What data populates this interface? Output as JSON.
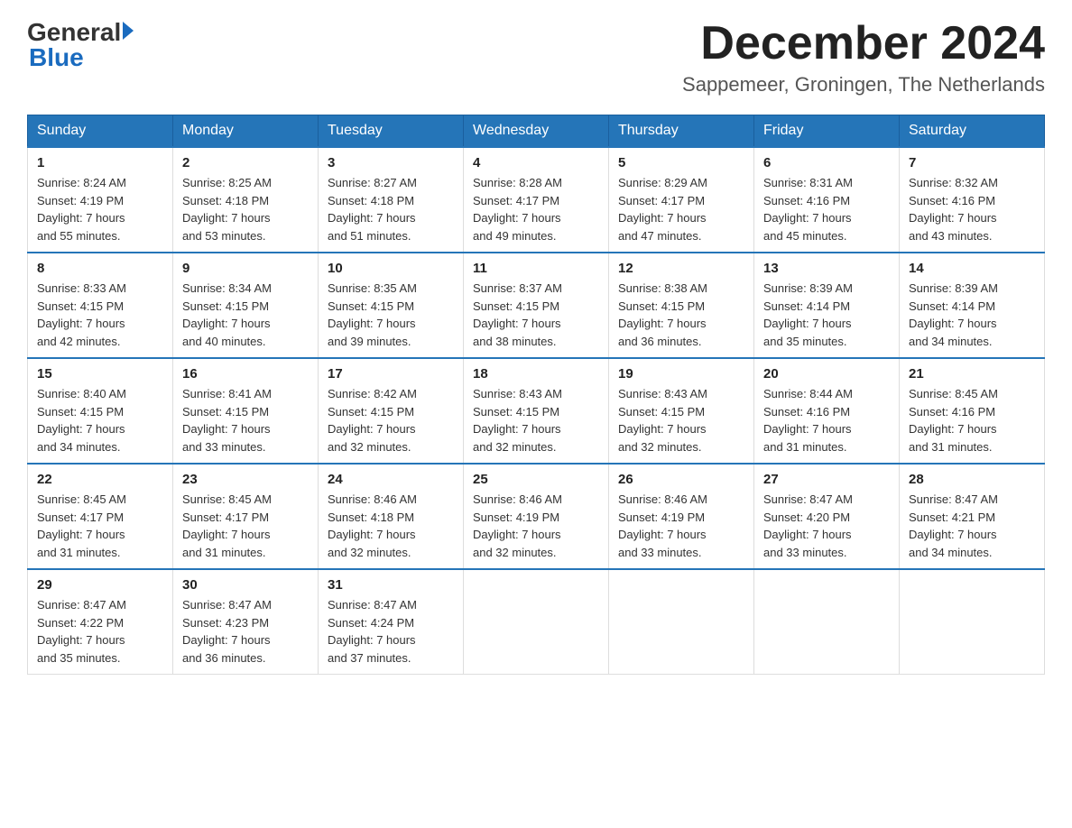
{
  "logo": {
    "general": "General",
    "blue": "Blue"
  },
  "header": {
    "month_year": "December 2024",
    "location": "Sappemeer, Groningen, The Netherlands"
  },
  "weekdays": [
    "Sunday",
    "Monday",
    "Tuesday",
    "Wednesday",
    "Thursday",
    "Friday",
    "Saturday"
  ],
  "weeks": [
    [
      {
        "day": "1",
        "sunrise": "8:24 AM",
        "sunset": "4:19 PM",
        "daylight": "7 hours and 55 minutes."
      },
      {
        "day": "2",
        "sunrise": "8:25 AM",
        "sunset": "4:18 PM",
        "daylight": "7 hours and 53 minutes."
      },
      {
        "day": "3",
        "sunrise": "8:27 AM",
        "sunset": "4:18 PM",
        "daylight": "7 hours and 51 minutes."
      },
      {
        "day": "4",
        "sunrise": "8:28 AM",
        "sunset": "4:17 PM",
        "daylight": "7 hours and 49 minutes."
      },
      {
        "day": "5",
        "sunrise": "8:29 AM",
        "sunset": "4:17 PM",
        "daylight": "7 hours and 47 minutes."
      },
      {
        "day": "6",
        "sunrise": "8:31 AM",
        "sunset": "4:16 PM",
        "daylight": "7 hours and 45 minutes."
      },
      {
        "day": "7",
        "sunrise": "8:32 AM",
        "sunset": "4:16 PM",
        "daylight": "7 hours and 43 minutes."
      }
    ],
    [
      {
        "day": "8",
        "sunrise": "8:33 AM",
        "sunset": "4:15 PM",
        "daylight": "7 hours and 42 minutes."
      },
      {
        "day": "9",
        "sunrise": "8:34 AM",
        "sunset": "4:15 PM",
        "daylight": "7 hours and 40 minutes."
      },
      {
        "day": "10",
        "sunrise": "8:35 AM",
        "sunset": "4:15 PM",
        "daylight": "7 hours and 39 minutes."
      },
      {
        "day": "11",
        "sunrise": "8:37 AM",
        "sunset": "4:15 PM",
        "daylight": "7 hours and 38 minutes."
      },
      {
        "day": "12",
        "sunrise": "8:38 AM",
        "sunset": "4:15 PM",
        "daylight": "7 hours and 36 minutes."
      },
      {
        "day": "13",
        "sunrise": "8:39 AM",
        "sunset": "4:14 PM",
        "daylight": "7 hours and 35 minutes."
      },
      {
        "day": "14",
        "sunrise": "8:39 AM",
        "sunset": "4:14 PM",
        "daylight": "7 hours and 34 minutes."
      }
    ],
    [
      {
        "day": "15",
        "sunrise": "8:40 AM",
        "sunset": "4:15 PM",
        "daylight": "7 hours and 34 minutes."
      },
      {
        "day": "16",
        "sunrise": "8:41 AM",
        "sunset": "4:15 PM",
        "daylight": "7 hours and 33 minutes."
      },
      {
        "day": "17",
        "sunrise": "8:42 AM",
        "sunset": "4:15 PM",
        "daylight": "7 hours and 32 minutes."
      },
      {
        "day": "18",
        "sunrise": "8:43 AM",
        "sunset": "4:15 PM",
        "daylight": "7 hours and 32 minutes."
      },
      {
        "day": "19",
        "sunrise": "8:43 AM",
        "sunset": "4:15 PM",
        "daylight": "7 hours and 32 minutes."
      },
      {
        "day": "20",
        "sunrise": "8:44 AM",
        "sunset": "4:16 PM",
        "daylight": "7 hours and 31 minutes."
      },
      {
        "day": "21",
        "sunrise": "8:45 AM",
        "sunset": "4:16 PM",
        "daylight": "7 hours and 31 minutes."
      }
    ],
    [
      {
        "day": "22",
        "sunrise": "8:45 AM",
        "sunset": "4:17 PM",
        "daylight": "7 hours and 31 minutes."
      },
      {
        "day": "23",
        "sunrise": "8:45 AM",
        "sunset": "4:17 PM",
        "daylight": "7 hours and 31 minutes."
      },
      {
        "day": "24",
        "sunrise": "8:46 AM",
        "sunset": "4:18 PM",
        "daylight": "7 hours and 32 minutes."
      },
      {
        "day": "25",
        "sunrise": "8:46 AM",
        "sunset": "4:19 PM",
        "daylight": "7 hours and 32 minutes."
      },
      {
        "day": "26",
        "sunrise": "8:46 AM",
        "sunset": "4:19 PM",
        "daylight": "7 hours and 33 minutes."
      },
      {
        "day": "27",
        "sunrise": "8:47 AM",
        "sunset": "4:20 PM",
        "daylight": "7 hours and 33 minutes."
      },
      {
        "day": "28",
        "sunrise": "8:47 AM",
        "sunset": "4:21 PM",
        "daylight": "7 hours and 34 minutes."
      }
    ],
    [
      {
        "day": "29",
        "sunrise": "8:47 AM",
        "sunset": "4:22 PM",
        "daylight": "7 hours and 35 minutes."
      },
      {
        "day": "30",
        "sunrise": "8:47 AM",
        "sunset": "4:23 PM",
        "daylight": "7 hours and 36 minutes."
      },
      {
        "day": "31",
        "sunrise": "8:47 AM",
        "sunset": "4:24 PM",
        "daylight": "7 hours and 37 minutes."
      },
      null,
      null,
      null,
      null
    ]
  ],
  "labels": {
    "sunrise": "Sunrise:",
    "sunset": "Sunset:",
    "daylight": "Daylight:"
  }
}
